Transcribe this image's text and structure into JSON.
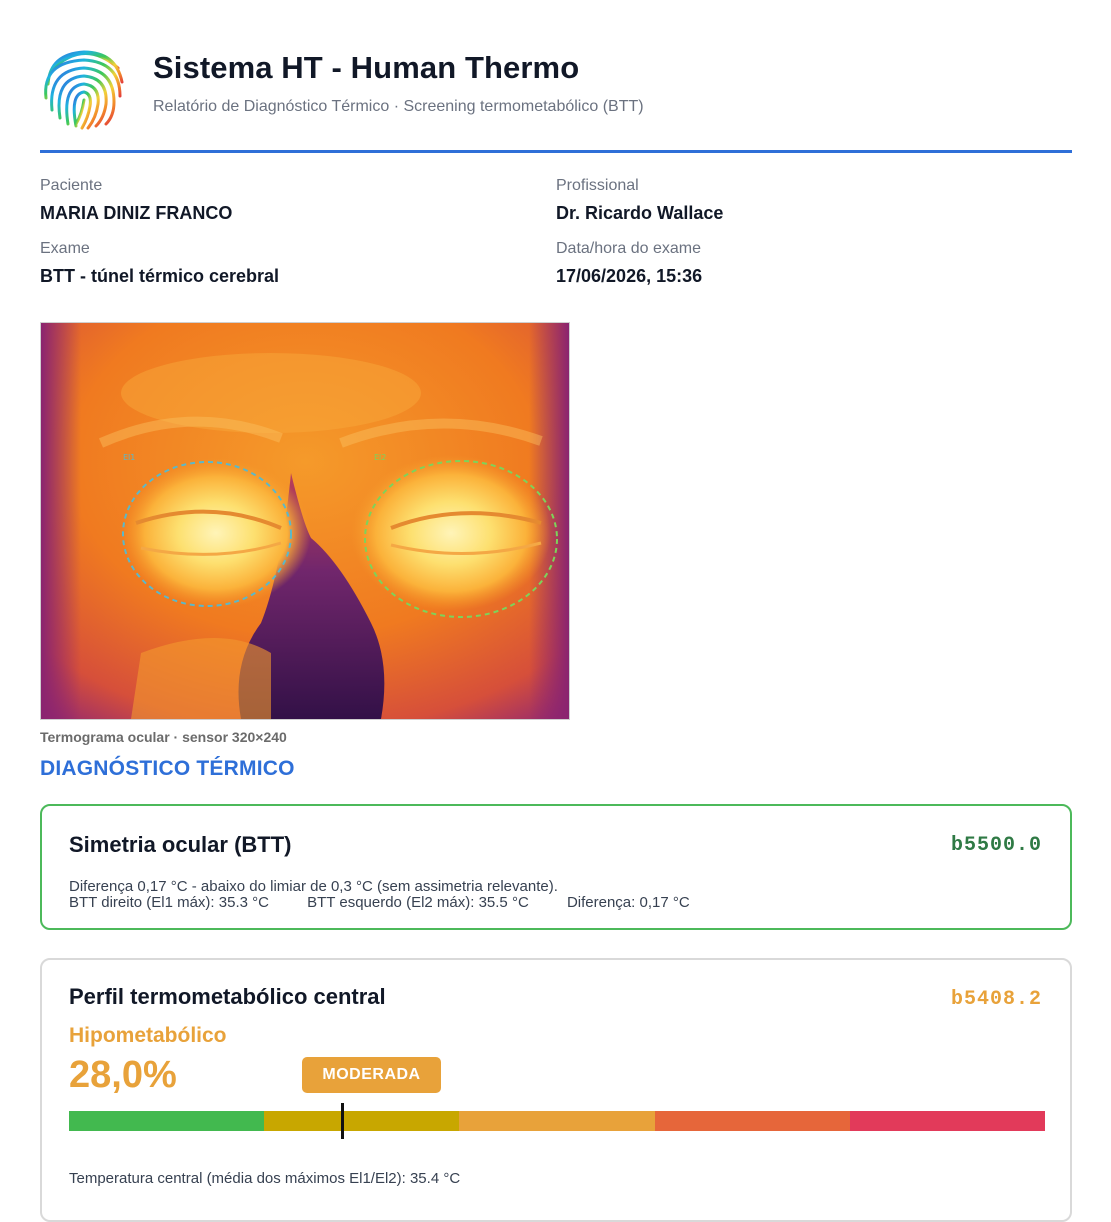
{
  "header": {
    "title": "Sistema HT - Human Thermo",
    "subtitle": "Relatório de Diagnóstico Térmico · Screening termometabólico (BTT)",
    "logo_icon": "fingerprint-rainbow-icon"
  },
  "info": {
    "patient_label": "Paciente",
    "patient_value": "MARIA DINIZ FRANCO",
    "professional_label": "Profissional",
    "professional_value": "Dr. Ricardo Wallace",
    "exam_label": "Exame",
    "exam_value": "BTT - túnel térmico cerebral",
    "datetime_label": "Data/hora do exame",
    "datetime_value": "17/06/2026, 15:36"
  },
  "thermogram": {
    "caption": "Termograma ocular · sensor 320×240",
    "roi_left_label": "El1",
    "roi_right_label": "El2",
    "roi_left_color": "#5bb8c9",
    "roi_right_color": "#7dd35a"
  },
  "section_title": "DIAGNÓSTICO TÉRMICO",
  "symmetry": {
    "title": "Simetria ocular (BTT)",
    "code": "b5500.0",
    "note": "Diferença 0,17 °C - abaixo do limiar de 0,3 °C (sem assimetria relevante).",
    "right": "BTT direito (El1 máx): 35.3 °C",
    "left": "BTT esquerdo (El2 máx): 35.5 °C",
    "diff": "Diferença: 0,17 °C",
    "border_color": "#4cb95a"
  },
  "profile": {
    "title": "Perfil termometabólico central",
    "code": "b5408.2",
    "category": "Hipometabólico",
    "percent_text": "28,0%",
    "percent_value": 28.0,
    "badge": "MODERADA",
    "accent_color": "#e8a23a",
    "scale_colors": [
      "#42b94f",
      "#c8a700",
      "#e8a23a",
      "#e6663a",
      "#e23a5a"
    ],
    "central_temp": "Temperatura central (média dos máximos El1/El2): 35.4 °C"
  }
}
